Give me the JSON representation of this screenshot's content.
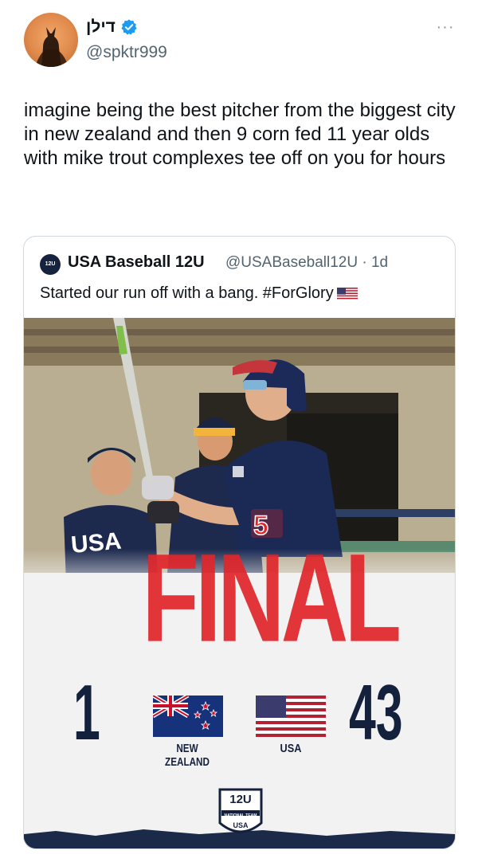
{
  "author": {
    "display_name": "דילן",
    "handle": "@spktr999",
    "verified_icon": "verified-badge-icon",
    "more_icon": "ellipsis-icon"
  },
  "tweet": {
    "text": "imagine being the best pitcher from the biggest city in new zealand and then 9 corn fed 11 year olds with mike trout complexes tee off on you for hours"
  },
  "quoted_tweet": {
    "author_name": "USA Baseball 12U",
    "handle_and_time": "@USABaseball12U · 1d",
    "avatar_text": "12U",
    "text": "Started our run off with a bang. #ForGlory",
    "flag_emoji_icon": "us-flag-icon",
    "media": {
      "headline": "FINAL",
      "score_left": "1",
      "score_right": "43",
      "team_left": "NEW ZEALAND",
      "team_right": "USA",
      "logo_title": "12U",
      "logo_subtitle": "NATIONAL TEAM",
      "logo_mark": "USA",
      "jersey_number": "5",
      "jersey_text": "USA"
    }
  },
  "colors": {
    "verified_blue": "#1d9bf0",
    "final_red": "#e0262b",
    "score_navy": "#14213d"
  }
}
